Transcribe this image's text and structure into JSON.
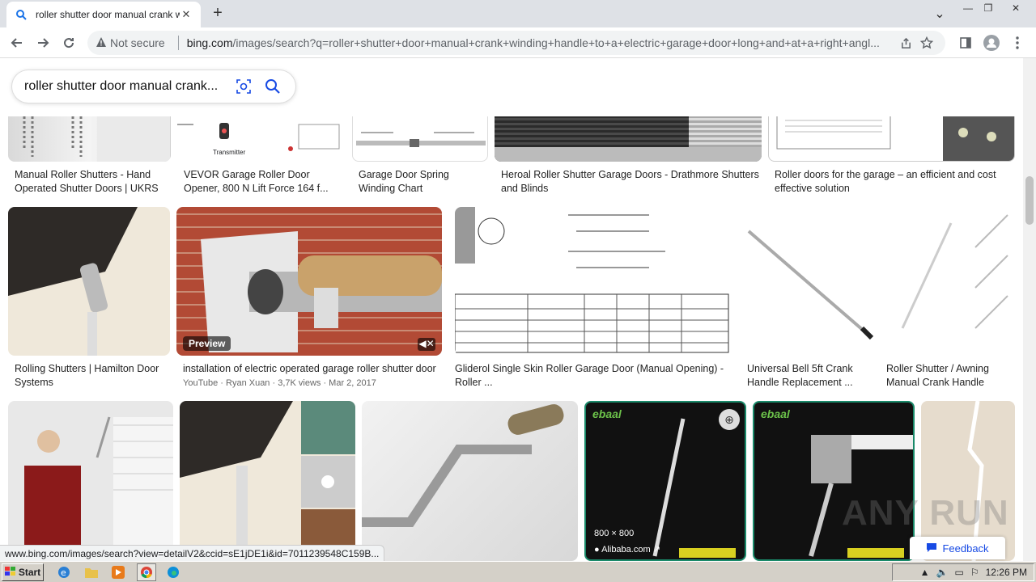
{
  "tab": {
    "title": "roller shutter door manual crank wir",
    "close": "✕",
    "new": "+"
  },
  "window": {
    "minimize": "—",
    "restore": "❐",
    "close": "✕",
    "tabsearch": "⌄"
  },
  "address": {
    "security": "Not secure",
    "host": "bing.com",
    "path": "/images/search?q=roller+shutter+door+manual+crank+winding+handle+to+a+electric+garage+door+long+and+at+a+right+angl..."
  },
  "search": {
    "query": "roller shutter door manual crank..."
  },
  "results": {
    "row1": [
      {
        "caption": "Manual Roller Shutters - Hand Operated Shutter Doors | UKRS"
      },
      {
        "caption": "VEVOR Garage Roller Door Opener, 800 N Lift Force 164 f...",
        "label": "Transmitter"
      },
      {
        "caption": "Garage Door Spring Winding Chart"
      },
      {
        "caption": "Heroal Roller Shutter Garage Doors - Drathmore Shutters and Blinds"
      },
      {
        "caption": "Roller doors for the garage – an efficient and cost effective solution"
      }
    ],
    "row2": [
      {
        "caption": "Rolling Shutters | Hamilton Door Systems"
      },
      {
        "caption": "installation of electric operated garage roller shutter door",
        "sub": "YouTube · Ryan Xuan · 3,7K views · Mar 2, 2017",
        "badge": "Preview"
      },
      {
        "caption": "Gliderol Single Skin Roller Garage Door (Manual Opening) - Roller ..."
      },
      {
        "caption": "Universal Bell 5ft Crank Handle Replacement ..."
      },
      {
        "caption": "Roller Shutter / Awning Manual Crank Handle"
      }
    ],
    "row3": [
      {
        "caption": ""
      },
      {
        "caption": ""
      },
      {
        "caption": ""
      },
      {
        "caption": "",
        "dims": "800 × 800",
        "source": "Alibaba.com",
        "brand": "ebaal"
      },
      {
        "caption": "",
        "brand": "ebaal"
      },
      {
        "caption": ""
      }
    ]
  },
  "status_url": "www.bing.com/images/search?view=detailV2&ccid=sE1jDE1i&id=7011239548C159B...",
  "feedback": "Feedback",
  "watermark": "ANY RUN",
  "taskbar": {
    "start": "Start",
    "clock": "12:26 PM"
  }
}
